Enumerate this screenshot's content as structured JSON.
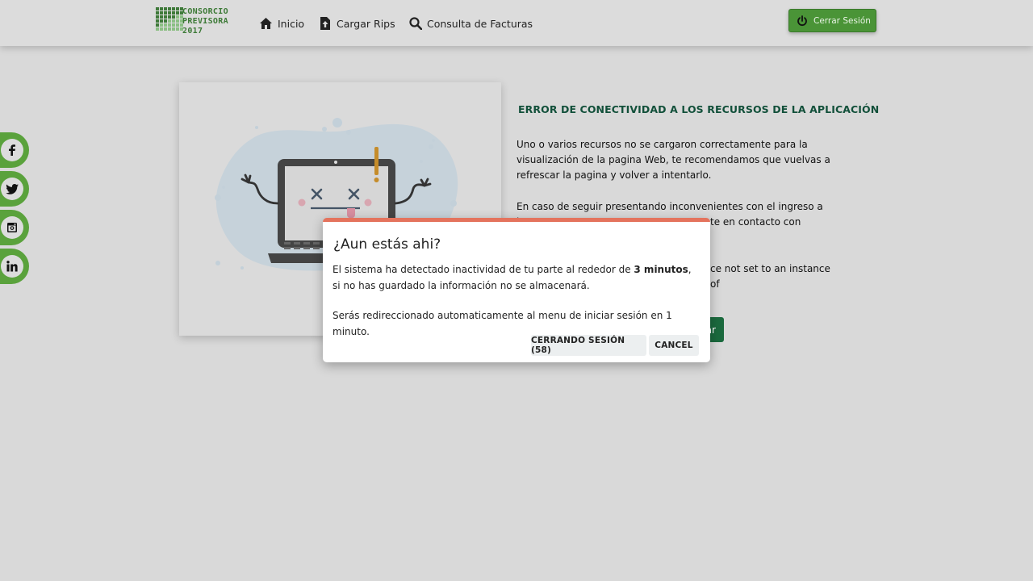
{
  "header": {
    "logo": {
      "line1": "CONSORCIO",
      "line2": "PREVISORA",
      "line3": "2017"
    },
    "nav": [
      {
        "label": "Inicio",
        "icon": "home-icon"
      },
      {
        "label": "Cargar Rips",
        "icon": "file-upload-icon"
      },
      {
        "label": "Consulta de Facturas",
        "icon": "search-icon"
      }
    ],
    "logout_label": "Cerrar Sesión",
    "logout_icon": "power-icon"
  },
  "social": [
    {
      "name": "facebook",
      "glyph": "f"
    },
    {
      "name": "twitter",
      "glyph": "t"
    },
    {
      "name": "instagram",
      "glyph": "ig"
    },
    {
      "name": "linkedin",
      "glyph": "in"
    }
  ],
  "error": {
    "title": "ERROR DE CONECTIVIDAD A LOS RECURSOS DE LA APLICACIÓN",
    "p1": "Uno o varios recursos no se cargaron correctamente para la visualización de la pagina Web, te recomendamos que vuelvas a refrescar la pagina y volver a intentarlo.",
    "p2": "En caso de seguir presentando inconvenientes con el ingreso a los",
    "p2b": "te en contacto con",
    "p3": "ce not set to an instance of",
    "retry_label": "ar"
  },
  "modal": {
    "title": "¿Aun estás ahi?",
    "p1_before": "El sistema ha detectado inactividad de tu parte al rededor de ",
    "p1_bold": "3 minutos",
    "p1_after": ", si no has guardado la información no se almacenará.",
    "p2": "Serás redireccionado automaticamente al menu de iniciar sesión en 1 minuto.",
    "btn_logout": "CERRANDO SESIÓN (58)",
    "btn_cancel": "CANCEL",
    "accent": "#e4735d"
  },
  "colors": {
    "brand_green": "#4a9437",
    "title_green": "#12503a",
    "social_green": "#5aa23c"
  }
}
